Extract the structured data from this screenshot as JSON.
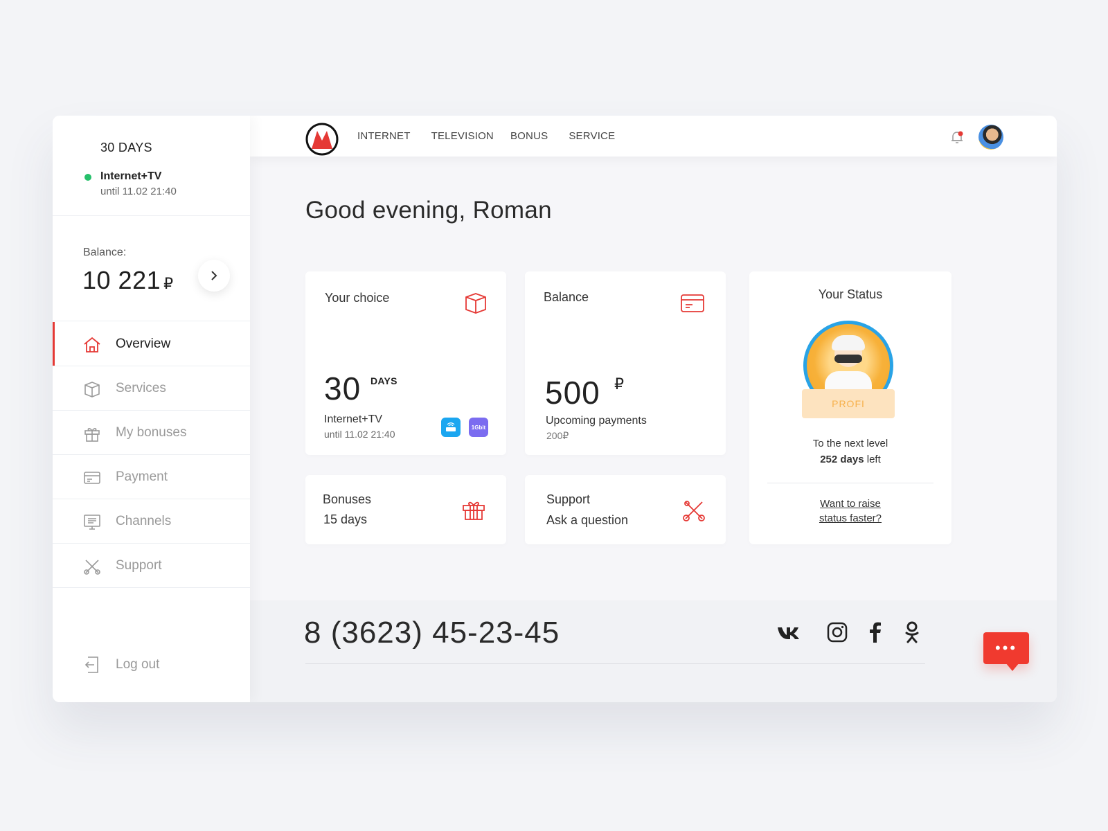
{
  "sidebar": {
    "plan": {
      "days": "30 DAYS",
      "name": "Internet+TV",
      "until": "until 11.02 21:40",
      "status_color": "#26c06b"
    },
    "balance": {
      "label": "Balance:",
      "amount": "10 221",
      "currency": "₽"
    },
    "nav": [
      {
        "label": "Overview",
        "icon": "home-icon",
        "active": true
      },
      {
        "label": "Services",
        "icon": "box-icon"
      },
      {
        "label": "My bonuses",
        "icon": "gift-icon"
      },
      {
        "label": "Payment",
        "icon": "card-icon"
      },
      {
        "label": "Channels",
        "icon": "tv-icon"
      },
      {
        "label": "Support",
        "icon": "tools-icon"
      }
    ],
    "logout": "Log out"
  },
  "topbar": {
    "menu": [
      "INTERNET",
      "TELEVISION",
      "BONUS",
      "SERVICE"
    ]
  },
  "main": {
    "greeting": "Good evening, Roman",
    "cards": {
      "choice": {
        "title": "Your choice",
        "days": "30",
        "days_unit": "DAYS",
        "plan": "Internet+TV",
        "until": "until 11.02 21:40",
        "badge_speed": "1Gbit"
      },
      "balance": {
        "title": "Balance",
        "amount": "500",
        "currency": "₽",
        "upcoming_label": "Upcoming payments",
        "upcoming_amount": "200₽"
      },
      "bonuses": {
        "title": "Bonuses",
        "value": "15 days"
      },
      "support": {
        "title": "Support",
        "value": "Ask a question"
      },
      "status": {
        "title": "Your Status",
        "level": "PROFI",
        "next_label": "To the next level",
        "days_bold": "252 days",
        "days_rest": " left",
        "link_line1": "Want to raise",
        "link_line2": "status faster?"
      }
    }
  },
  "footer": {
    "phone": "8 (3623) 45-23-45",
    "socials": [
      "vk-icon",
      "instagram-icon",
      "facebook-icon",
      "odnoklassniki-icon"
    ]
  },
  "colors": {
    "accent": "#e53935",
    "chat": "#f03a2f",
    "router_badge": "#1ba6f0",
    "speed_badge": "#7b6cf0"
  }
}
